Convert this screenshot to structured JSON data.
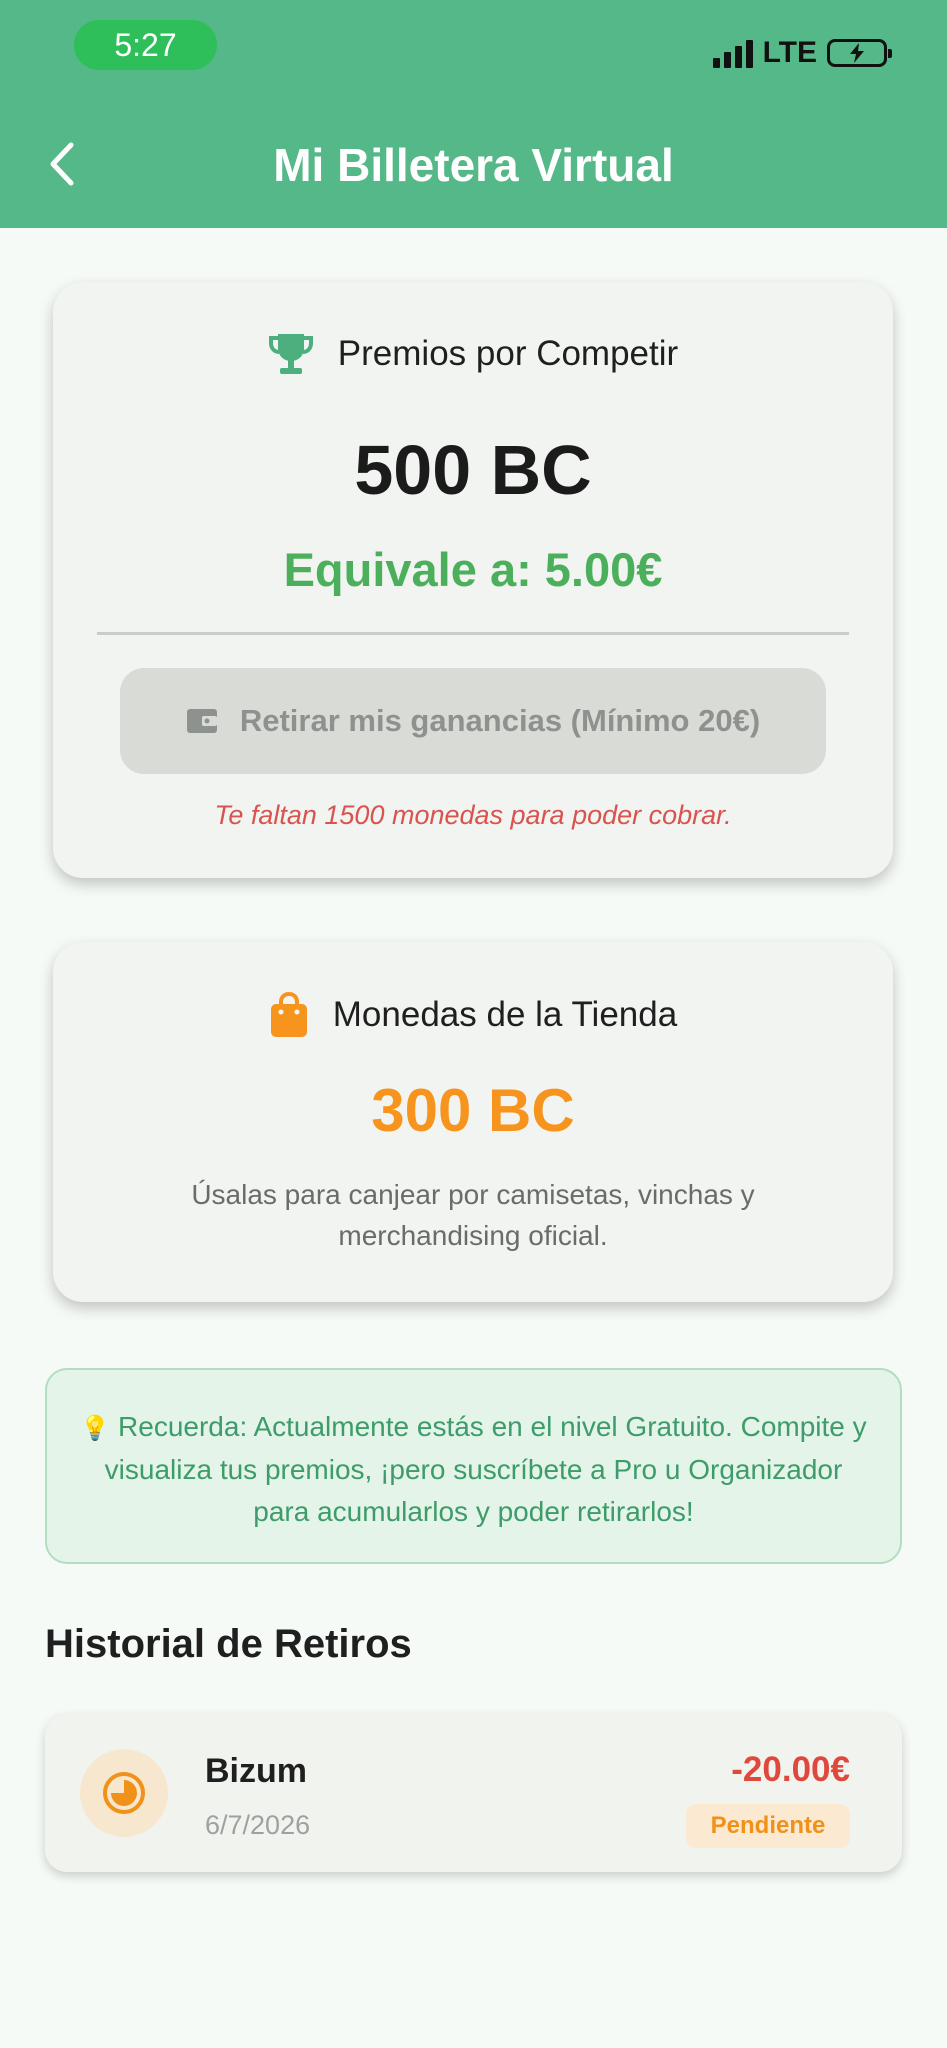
{
  "status_bar": {
    "time": "5:27",
    "network": "LTE",
    "battery_icon": "battery-charging-icon",
    "signal_icon": "cellular-signal-icon"
  },
  "header": {
    "back_icon": "chevron-left-icon",
    "title": "Mi Billetera Virtual"
  },
  "prizes_card": {
    "icon": "trophy-icon",
    "title": "Premios por Competir",
    "amount": "500 BC",
    "equivalent": "Equivale a: 5.00€",
    "withdraw_icon": "wallet-icon",
    "withdraw_label": "Retirar mis ganancias (Mínimo 20€)",
    "warning": "Te faltan 1500 monedas para poder cobrar."
  },
  "store_card": {
    "icon": "shopping-bag-icon",
    "title": "Monedas de la Tienda",
    "amount": "300 BC",
    "description": "Úsalas para canjear por camisetas, vinchas y merchandising oficial."
  },
  "notice": {
    "icon": "💡",
    "text": "Recuerda: Actualmente estás en el nivel Gratuito. Compite y visualiza tus premios, ¡pero suscríbete a Pro u Organizador para acumularlos y poder retirarlos!"
  },
  "history": {
    "title": "Historial de Retiros",
    "items": [
      {
        "icon": "pending-clock-icon",
        "method": "Bizum",
        "date": "6/7/2026",
        "amount": "-20.00€",
        "status": "Pendiente"
      }
    ]
  },
  "colors": {
    "primary": "#55b888",
    "accent_green": "#4caf5c",
    "store_orange": "#f7941d",
    "danger": "#e0483c"
  }
}
